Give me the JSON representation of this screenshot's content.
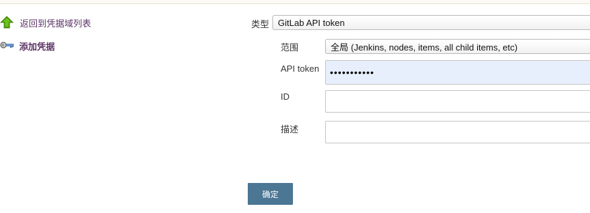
{
  "sidebar": {
    "back_label": "返回到凭据域列表",
    "add_label": "添加凭据",
    "back_icon": "arrow-up-icon",
    "add_icon": "key-icon"
  },
  "form": {
    "kind_label": "类型",
    "kind_value": "GitLab API token",
    "scope_label": "范围",
    "scope_value": "全局 (Jenkins, nodes, items, all child items, etc)",
    "api_token_label": "API token",
    "api_token_value": "•••••••••••",
    "id_label": "ID",
    "id_value": "",
    "description_label": "描述",
    "description_value": ""
  },
  "actions": {
    "ok_label": "确定",
    "ok_color": "#4b7694"
  }
}
